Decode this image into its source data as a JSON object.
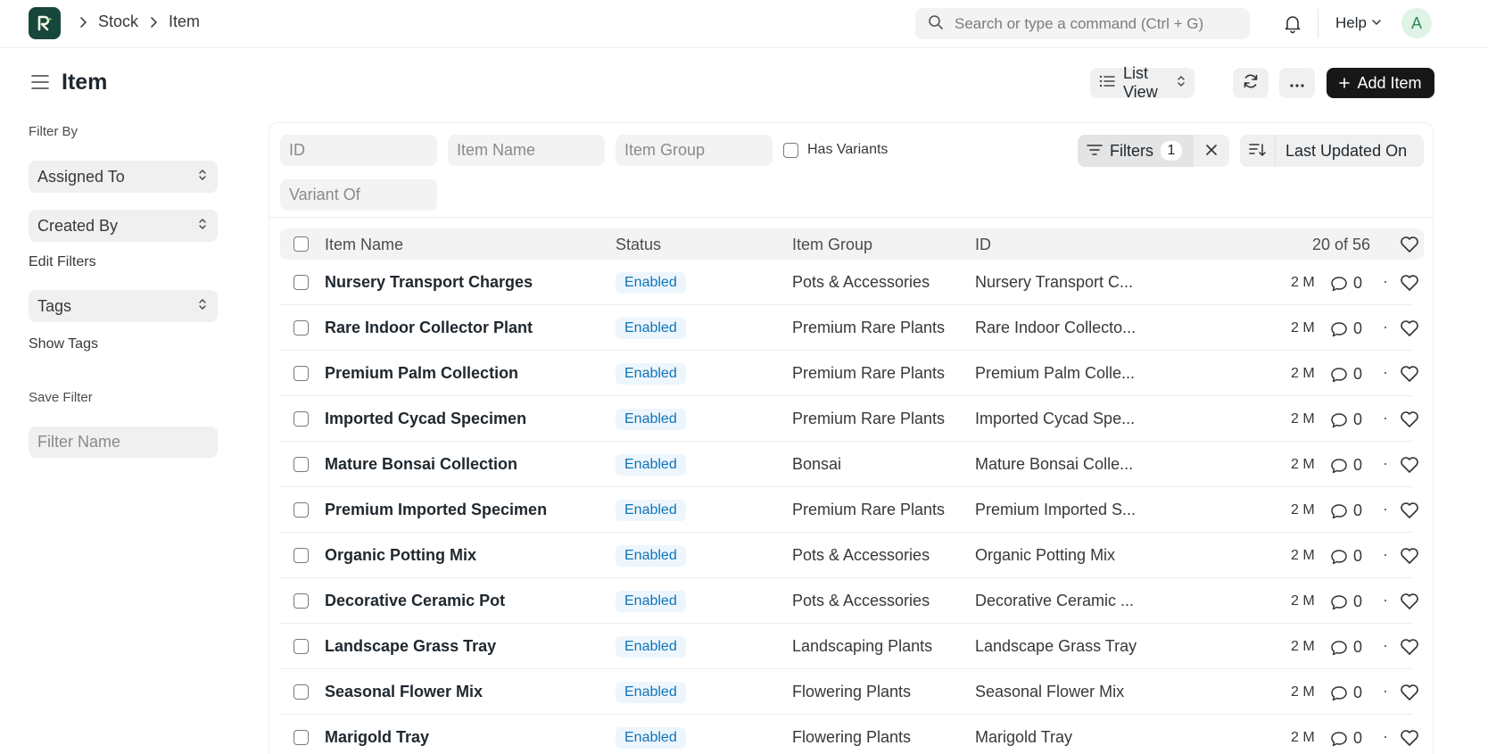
{
  "navbar": {
    "breadcrumbs": [
      "Stock",
      "Item"
    ],
    "search_placeholder": "Search or type a command (Ctrl + G)",
    "help_label": "Help",
    "avatar_initial": "A"
  },
  "header": {
    "title": "Item",
    "list_view_label": "List View",
    "add_label": "Add Item"
  },
  "sidebar": {
    "filter_by": "Filter By",
    "assigned_to": "Assigned To",
    "created_by": "Created By",
    "edit_filters": "Edit Filters",
    "tags": "Tags",
    "show_tags": "Show Tags",
    "save_filter": "Save Filter",
    "filter_name_placeholder": "Filter Name"
  },
  "filters": {
    "id_placeholder": "ID",
    "item_name_placeholder": "Item Name",
    "item_group_placeholder": "Item Group",
    "has_variants_label": "Has Variants",
    "variant_of_placeholder": "Variant Of",
    "filters_label": "Filters",
    "filters_count": "1",
    "sort_label": "Last Updated On"
  },
  "table": {
    "columns": {
      "item_name": "Item Name",
      "status": "Status",
      "item_group": "Item Group",
      "id": "ID"
    },
    "count_label": "20 of 56",
    "rows": [
      {
        "name": "Nursery Transport Charges",
        "status": "Enabled",
        "group": "Pots & Accessories",
        "id": "Nursery Transport C...",
        "age": "2 M",
        "comments": "0"
      },
      {
        "name": "Rare Indoor Collector Plant",
        "status": "Enabled",
        "group": "Premium Rare Plants",
        "id": "Rare Indoor Collecto...",
        "age": "2 M",
        "comments": "0"
      },
      {
        "name": "Premium Palm Collection",
        "status": "Enabled",
        "group": "Premium Rare Plants",
        "id": "Premium Palm Colle...",
        "age": "2 M",
        "comments": "0"
      },
      {
        "name": "Imported Cycad Specimen",
        "status": "Enabled",
        "group": "Premium Rare Plants",
        "id": "Imported Cycad Spe...",
        "age": "2 M",
        "comments": "0"
      },
      {
        "name": "Mature Bonsai Collection",
        "status": "Enabled",
        "group": "Bonsai",
        "id": "Mature Bonsai Colle...",
        "age": "2 M",
        "comments": "0"
      },
      {
        "name": "Premium Imported Specimen",
        "status": "Enabled",
        "group": "Premium Rare Plants",
        "id": "Premium Imported S...",
        "age": "2 M",
        "comments": "0"
      },
      {
        "name": "Organic Potting Mix",
        "status": "Enabled",
        "group": "Pots & Accessories",
        "id": "Organic Potting Mix",
        "age": "2 M",
        "comments": "0"
      },
      {
        "name": "Decorative Ceramic Pot",
        "status": "Enabled",
        "group": "Pots & Accessories",
        "id": "Decorative Ceramic ...",
        "age": "2 M",
        "comments": "0"
      },
      {
        "name": "Landscape Grass Tray",
        "status": "Enabled",
        "group": "Landscaping Plants",
        "id": "Landscape Grass Tray",
        "age": "2 M",
        "comments": "0"
      },
      {
        "name": "Seasonal Flower Mix",
        "status": "Enabled",
        "group": "Flowering Plants",
        "id": "Seasonal Flower Mix",
        "age": "2 M",
        "comments": "0"
      },
      {
        "name": "Marigold Tray",
        "status": "Enabled",
        "group": "Flowering Plants",
        "id": "Marigold Tray",
        "age": "2 M",
        "comments": "0"
      }
    ]
  },
  "colors": {
    "brand_logo": "#17463a",
    "primary_button": "#171717",
    "status_enabled_bg": "#edf6fd",
    "status_enabled_text": "#0f73b8"
  },
  "icons": [
    "app-logo-icon",
    "chevron-right-icon",
    "search-icon",
    "bell-icon",
    "chevron-down-icon",
    "hamburger-icon",
    "list-icon",
    "updown-icon",
    "refresh-icon",
    "more-icon",
    "plus-icon",
    "filter-icon",
    "close-icon",
    "sort-icon",
    "comment-icon",
    "heart-icon"
  ]
}
